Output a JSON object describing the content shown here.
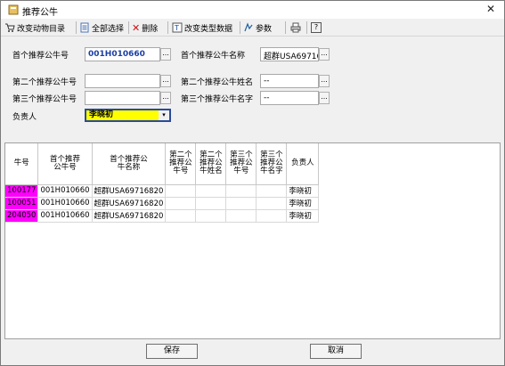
{
  "window": {
    "title": "推荐公牛",
    "close": "✕"
  },
  "toolbar": {
    "change_animal_dir": "改变动物目录",
    "select_all": "全部选择",
    "delete": "删除",
    "change_type_data": "改变类型数据",
    "params": "参数",
    "print_icon": "print-icon",
    "help": "?"
  },
  "form": {
    "first_bull_no_label": "首个推荐公牛号",
    "first_bull_no_value": "001H010660",
    "first_bull_name_label": "首个推荐公牛名称",
    "first_bull_name_value": "超群USA69716",
    "second_bull_no_label": "第二个推荐公牛号",
    "second_bull_no_value": "",
    "second_bull_name_label": "第二个推荐公牛姓名",
    "second_bull_name_value": "--",
    "third_bull_no_label": "第三个推荐公牛号",
    "third_bull_no_value": "",
    "third_bull_name_label": "第三个推荐公牛名字",
    "third_bull_name_value": "--",
    "owner_label": "负责人",
    "owner_value": "李晓初",
    "dots": "..."
  },
  "grid": {
    "headers": [
      "牛号",
      "首个推荐公牛号",
      "首个推荐公牛名称",
      "第二个推荐公牛号",
      "第二个推荐公牛姓名",
      "第三个推荐公牛号",
      "第三个推荐公牛名字",
      "负责人"
    ],
    "rows": [
      [
        "100177",
        "001H010660",
        "超群USA69716820",
        "",
        "",
        "",
        "",
        "李晓初"
      ],
      [
        "100051",
        "001H010660",
        "超群USA69716820",
        "",
        "",
        "",
        "",
        "李晓初"
      ],
      [
        "204050",
        "001H010660",
        "超群USA69716820",
        "",
        "",
        "",
        "",
        "李晓初"
      ]
    ],
    "highlight_color": "#ff00ff"
  },
  "buttons": {
    "save": "保存",
    "cancel": "取消"
  }
}
